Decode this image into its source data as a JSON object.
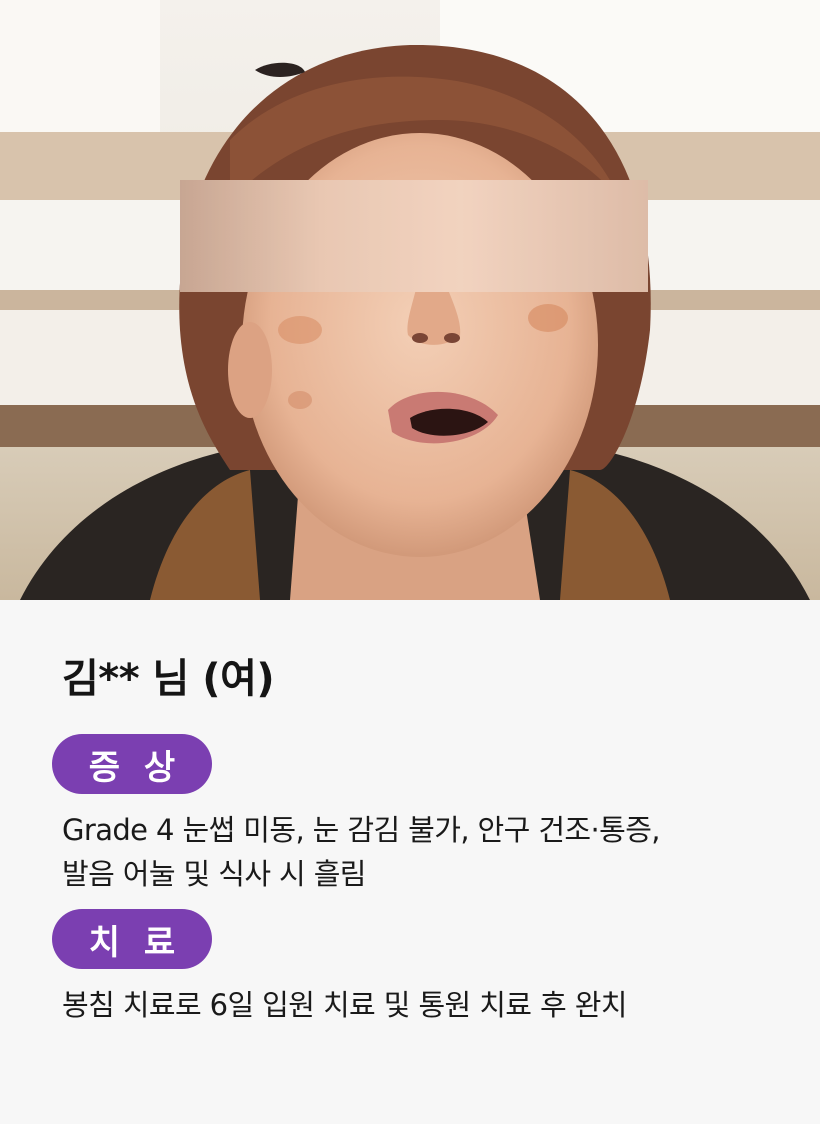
{
  "colors": {
    "accent": "#7b3fb1",
    "card_background": "#f7f7f7",
    "text": "#1a1a1a"
  },
  "photo": {
    "icon": "patient-face-photo",
    "privacy_mask": "blurred-eyes-bar"
  },
  "patient": {
    "name": "김** 님 (여)"
  },
  "symptoms": {
    "label": "증 상",
    "lines": [
      "Grade 4 눈썹 미동, 눈 감김 불가, 안구 건조·통증,",
      "발음 어눌 및 식사 시 흘림"
    ]
  },
  "treatment": {
    "label": "치 료",
    "lines": [
      "봉침 치료로 6일 입원 치료 및 통원 치료 후 완치"
    ]
  }
}
